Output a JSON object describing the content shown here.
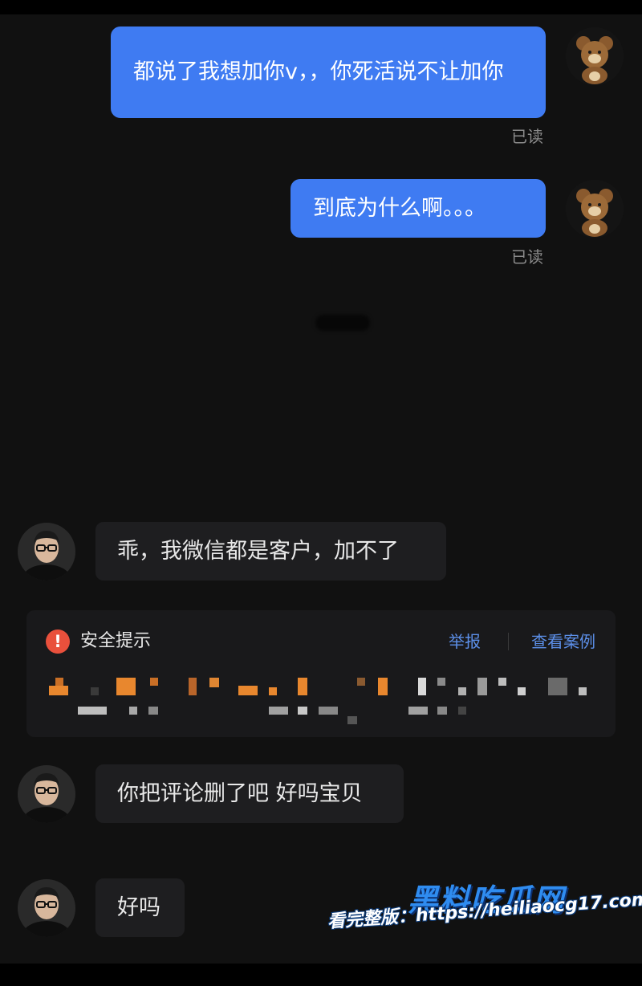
{
  "conversation": {
    "messages_sent": [
      {
        "text": "都说了我想加你v，，你死活说不让加你",
        "status": "已读"
      },
      {
        "text": "到底为什么啊。。。",
        "status": "已读"
      }
    ],
    "messages_received": [
      {
        "text": "乖，我微信都是客户，加不了"
      },
      {
        "text": "你把评论删了吧 好吗宝贝"
      },
      {
        "text": "好吗"
      }
    ]
  },
  "safety_notice": {
    "title": "安全提示",
    "report_label": "举报",
    "view_cases_label": "查看案例",
    "icon": "exclamation-icon"
  },
  "watermark": {
    "site_name": "黑料吃瓜网",
    "url_line": "看完整版：https://heiliaocg17.com"
  },
  "colors": {
    "sent_bubble": "#3f7bf2",
    "received_bubble": "#1e1e20",
    "background": "#111111",
    "link": "#5c8fe8",
    "warning": "#e9503c"
  }
}
